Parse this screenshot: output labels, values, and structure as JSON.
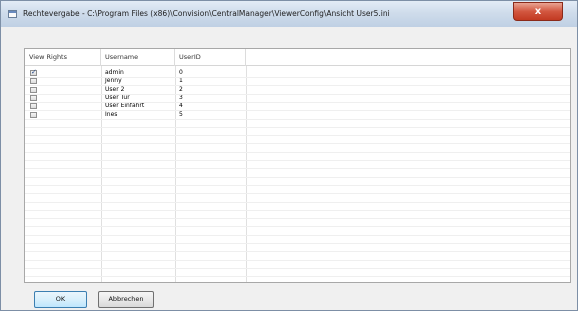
{
  "window": {
    "title": "Rechtevergabe - C:\\Program Files (x86)\\Convision\\CentralManager\\ViewerConfig\\Ansicht User5.ini",
    "close_label": "x"
  },
  "table": {
    "columns": [
      "View Rights",
      "Username",
      "UserID"
    ],
    "rows": [
      {
        "checked": true,
        "username": "admin",
        "userid": "0"
      },
      {
        "checked": false,
        "username": "Jenny",
        "userid": "1"
      },
      {
        "checked": false,
        "username": "User 2",
        "userid": "2"
      },
      {
        "checked": false,
        "username": "User Tür",
        "userid": "3"
      },
      {
        "checked": false,
        "username": "User Einfahrt",
        "userid": "4"
      },
      {
        "checked": false,
        "username": "Ines",
        "userid": "5"
      }
    ]
  },
  "buttons": {
    "ok": "OK",
    "cancel": "Abbrechen"
  }
}
